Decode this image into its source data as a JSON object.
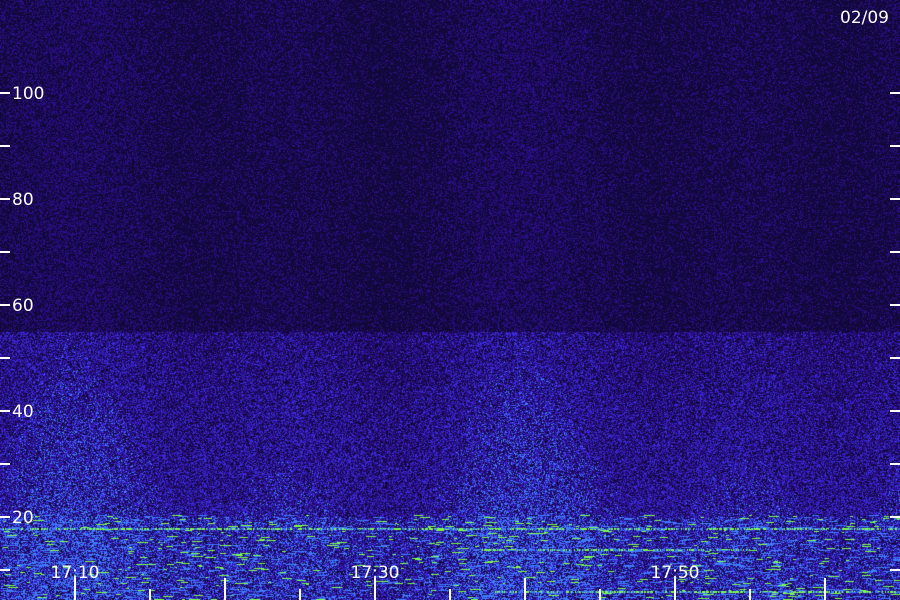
{
  "chart_data": {
    "type": "heatmap",
    "title": "",
    "date_label": "02/09",
    "xlabel": "",
    "ylabel": "",
    "ylim": [
      0,
      110
    ],
    "y_ticks_labeled": [
      20,
      40,
      60,
      80,
      100
    ],
    "y_ticks_minor": [
      10,
      30,
      50,
      70,
      90
    ],
    "x_range": [
      "17:05",
      "17:65"
    ],
    "x_ticks_labeled": [
      "17:10",
      "17:30",
      "17:50"
    ],
    "x_tick_interval_minutes": 5,
    "grid": false,
    "colors": {
      "background": "#12083a",
      "noise_low": "#2a0e88",
      "noise_mid": "#3a2ad8",
      "noise_high": "#3f7dff",
      "signal": "#7dff4a"
    },
    "bands": [
      {
        "freq_min": 50,
        "freq_max": 55,
        "intensity": "medium",
        "start": "17:05",
        "end": "17:65"
      },
      {
        "freq_min": 20,
        "freq_max": 50,
        "intensity": "medium",
        "start": "17:05",
        "end": "17:65"
      },
      {
        "freq_min": 0,
        "freq_max": 20,
        "intensity": "high",
        "start": "17:05",
        "end": "17:65"
      }
    ],
    "lines": [
      {
        "freq": 18,
        "intensity": "high",
        "start": "17:05",
        "end": "17:65"
      },
      {
        "freq": 14,
        "intensity": "high",
        "start": "17:37",
        "end": "17:55"
      },
      {
        "freq": 6,
        "intensity": "high",
        "start": "17:38",
        "end": "17:65"
      }
    ]
  }
}
